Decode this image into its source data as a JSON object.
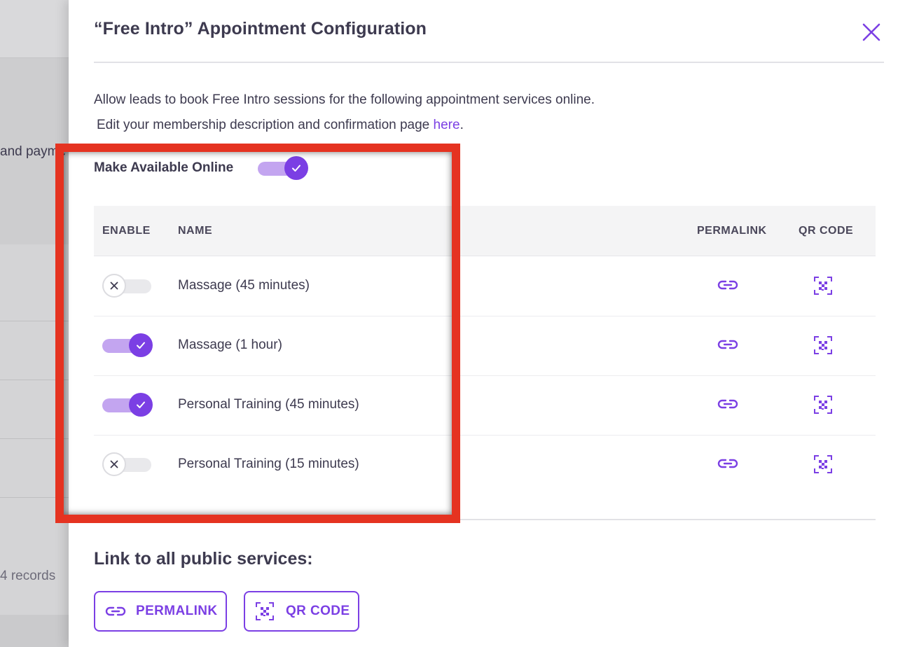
{
  "background": {
    "fragment_text": "and payme",
    "records_text": "4 records"
  },
  "panel": {
    "title": "“Free Intro” Appointment Configuration",
    "description_line1": "Allow leads to book Free Intro sessions for the following appointment services online.",
    "description_line2_prefix": "Edit your membership description and confirmation page",
    "description_link": "here",
    "description_suffix": ".",
    "make_available_label": "Make Available Online",
    "make_available_on": true
  },
  "table": {
    "headers": {
      "enable": "ENABLE",
      "name": "NAME",
      "permalink": "PERMALINK",
      "qr_code": "QR CODE"
    },
    "rows": [
      {
        "name": "Massage (45 minutes)",
        "enabled": false
      },
      {
        "name": "Massage (1 hour)",
        "enabled": true
      },
      {
        "name": "Personal Training (45 minutes)",
        "enabled": true
      },
      {
        "name": "Personal Training (15 minutes)",
        "enabled": false
      }
    ]
  },
  "footer": {
    "link_title": "Link to all public services:",
    "permalink_button": "PERMALINK",
    "qr_button": "QR CODE"
  },
  "colors": {
    "accent": "#7b3fe4",
    "accent_light": "#c3a5f0",
    "annotation": "#e53321"
  },
  "icons": [
    "close-icon",
    "check-icon",
    "x-icon",
    "link-icon",
    "qr-code-icon"
  ]
}
